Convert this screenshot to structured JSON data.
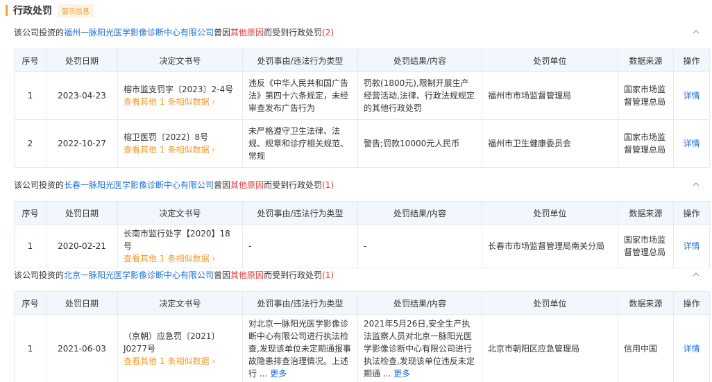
{
  "header": {
    "title": "行政处罚",
    "tag": "警示信息"
  },
  "columns": [
    "序号",
    "处罚日期",
    "决定文书号",
    "处罚事由/违法行为类型",
    "处罚结果/内容",
    "处罚单位",
    "数据来源",
    "操作"
  ],
  "common": {
    "prefix": "该公司投资的",
    "mid": "曾因",
    "reason": "其他原因",
    "suffix": "而受到行政处罚",
    "similar_prefix": "查看其他",
    "similar_count": "1",
    "similar_suffix": "条相似数据",
    "detail": "详情",
    "more": "更多",
    "ellipsis": "..."
  },
  "sections": [
    {
      "company": "福州一脉阳光医学影像诊断中心有限公司",
      "count": "(2)",
      "rows": [
        {
          "index": "1",
          "date": "2023-04-23",
          "doc": "榕市监支罚字〔2023〕2-4号",
          "reason": "违反《中华人民共和国广告法》第四十六条规定，未经审查发布广告行为",
          "result": "罚款(1800元),限制开展生产经营活动,法律、行政法规规定的其他行政处罚",
          "unit": "福州市市场监督管理局",
          "source": "国家市场监督管理总局"
        },
        {
          "index": "2",
          "date": "2022-10-27",
          "doc": "榕卫医罚〔2022〕8号",
          "reason": "未严格遵守卫生法律、法规、规章和诊疗相关规范、常规",
          "result": "警告;罚款10000元人民币",
          "unit": "福州市卫生健康委员会",
          "source": "国家市场监督管理总局"
        }
      ]
    },
    {
      "company": "长春一脉阳光医学影像诊断中心有限公司",
      "count": "(1)",
      "rows": [
        {
          "index": "1",
          "date": "2020-02-21",
          "doc": "长南市监行处字【2020】18号",
          "reason": "-",
          "result": "-",
          "unit": "长春市市场监督管理局南关分局",
          "source": "国家市场监督管理总局"
        }
      ]
    },
    {
      "company": "北京一脉阳光医学影像诊断中心有限公司",
      "count": "(1)",
      "rows": [
        {
          "index": "1",
          "date": "2021-06-03",
          "doc": "（京朝）应急罚〔2021〕J0277号",
          "reason": "对北京一脉阳光医学影像诊断中心有限公司进行执法检查,发现该单位未定期通报事故隐患排查治理情况。上述行",
          "result": "2021年5月26日,安全生产执法监察人员对北京一脉阳光医学影像诊断中心有限公司进行执法检查,发现该单位违反未定期通",
          "unit": "北京市朝阳区应急管理局",
          "source": "信用中国"
        }
      ]
    }
  ]
}
